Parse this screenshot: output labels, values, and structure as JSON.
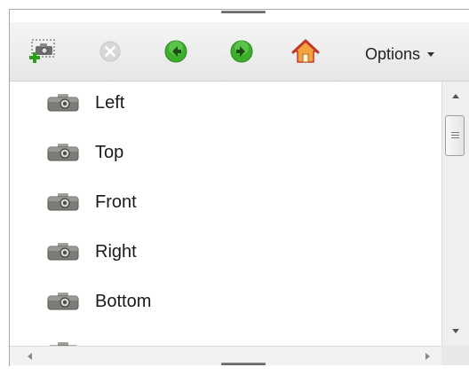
{
  "toolbar": {
    "buttons": [
      {
        "name": "add-view",
        "icon": "camera-add-icon"
      },
      {
        "name": "delete-view",
        "icon": "close-circle-icon"
      },
      {
        "name": "back",
        "icon": "arrow-left-circle-icon"
      },
      {
        "name": "forward",
        "icon": "arrow-right-circle-icon"
      },
      {
        "name": "home",
        "icon": "home-icon"
      }
    ],
    "options_label": "Options"
  },
  "views": {
    "items": [
      {
        "label": "Left",
        "icon": "camera-icon"
      },
      {
        "label": "Top",
        "icon": "camera-icon"
      },
      {
        "label": "Front",
        "icon": "camera-icon"
      },
      {
        "label": "Right",
        "icon": "camera-icon"
      },
      {
        "label": "Bottom",
        "icon": "camera-icon"
      }
    ]
  },
  "colors": {
    "toolbar_bg": "#ececec",
    "nav_green": "#3cae2b",
    "home_orange": "#e08a1e",
    "disabled_gray": "#c8c8c8"
  }
}
